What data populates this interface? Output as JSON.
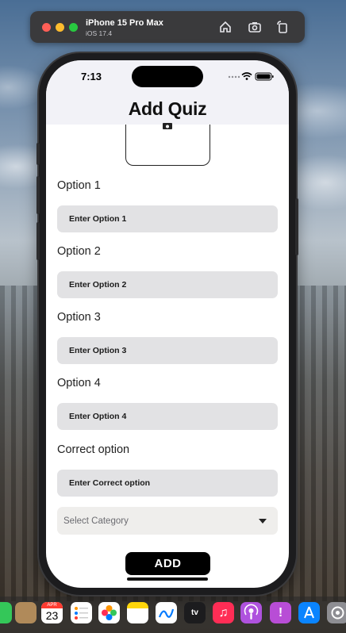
{
  "simulator": {
    "device_name": "iPhone 15 Pro Max",
    "os_version": "iOS 17.4"
  },
  "status_bar": {
    "time": "7:13"
  },
  "page": {
    "title": "Add Quiz"
  },
  "options": [
    {
      "label": "Option 1",
      "placeholder": "Enter Option 1"
    },
    {
      "label": "Option 2",
      "placeholder": "Enter Option 2"
    },
    {
      "label": "Option 3",
      "placeholder": "Enter Option 3"
    },
    {
      "label": "Option 4",
      "placeholder": "Enter Option 4"
    },
    {
      "label": "Correct option",
      "placeholder": "Enter Correct option"
    }
  ],
  "category": {
    "placeholder": "Select Category"
  },
  "add_button": {
    "label": "ADD"
  },
  "dock": {
    "calendar_month": "APR",
    "calendar_day": "23",
    "tv_label": "tv"
  },
  "colors": {
    "header_bg": "#f2f2f7",
    "field_bg": "#e2e2e4",
    "button_bg": "#000000"
  }
}
